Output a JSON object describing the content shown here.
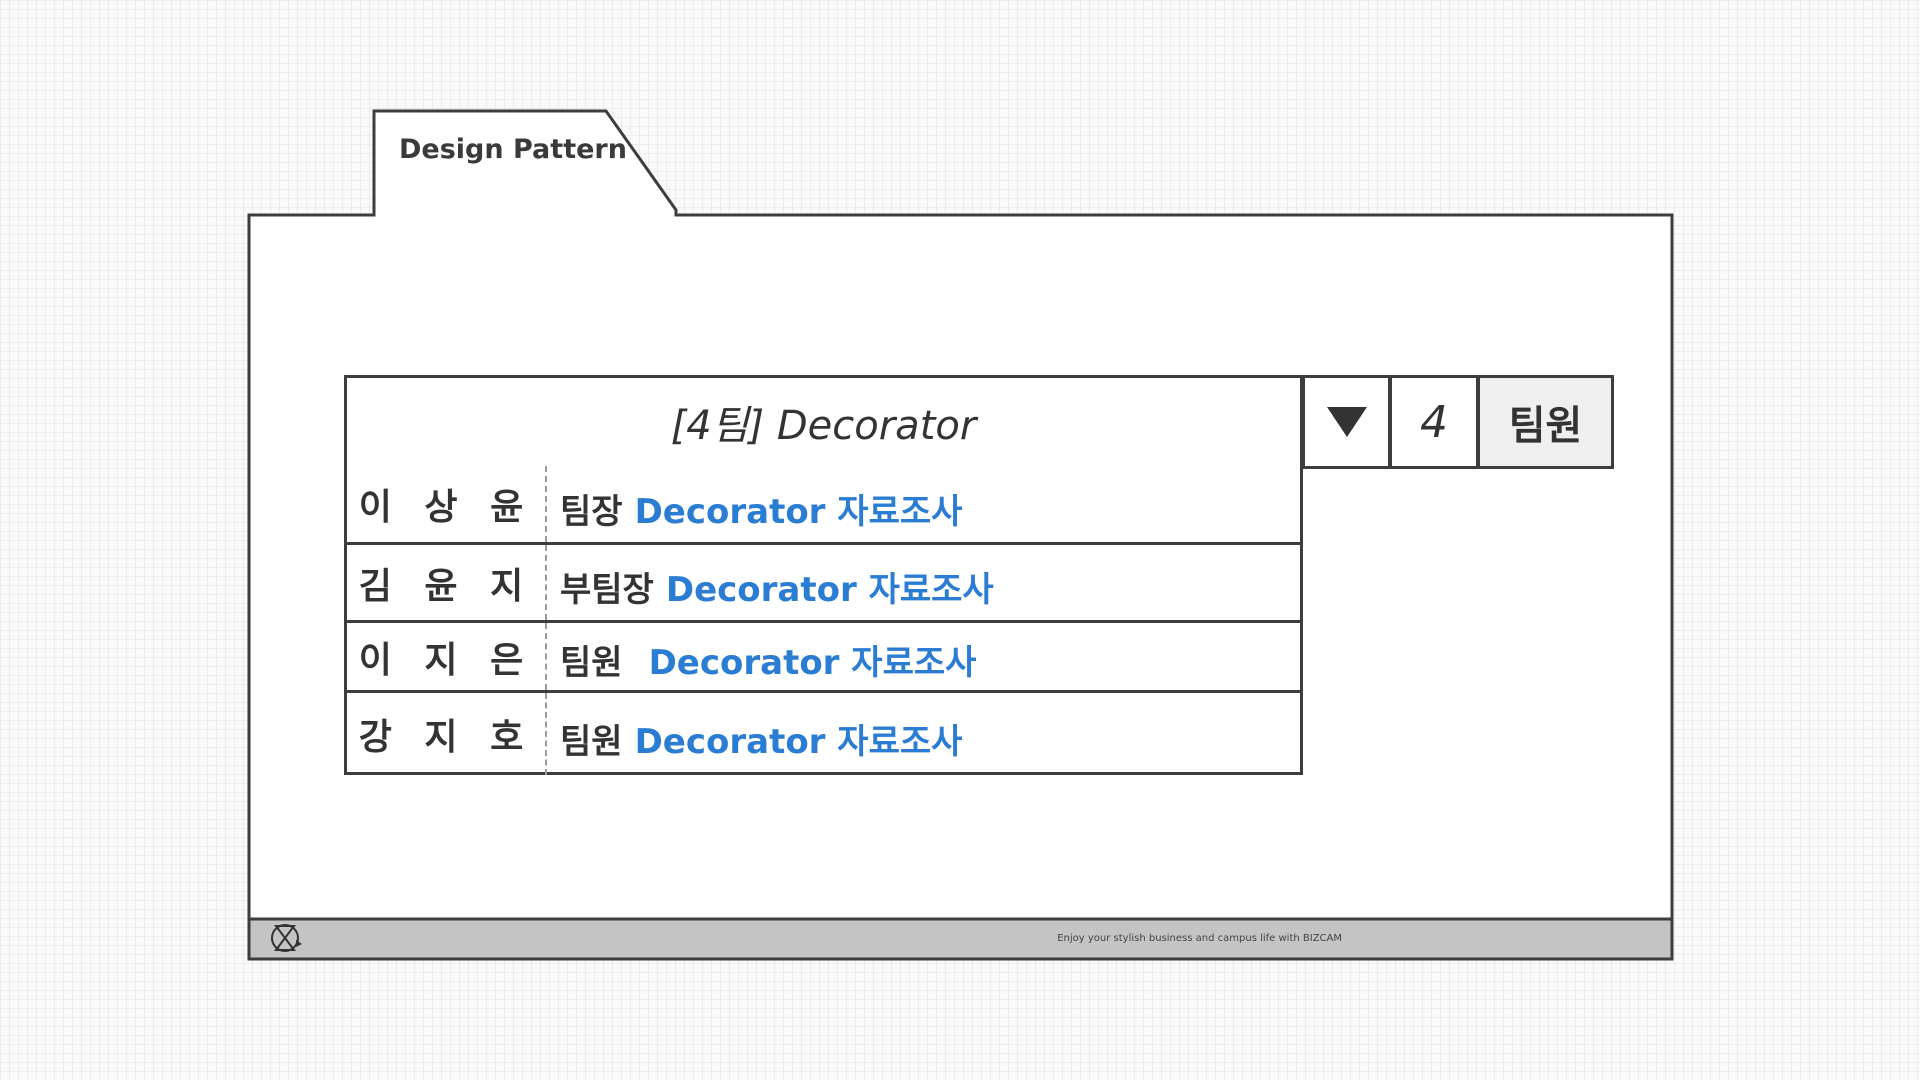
{
  "tab": {
    "label": "Design Pattern"
  },
  "header": {
    "title": "[4팀] Decorator",
    "dropdown_icon": "triangle-down-icon",
    "count": "4",
    "role": "팀원"
  },
  "members": [
    {
      "name": "이 상 윤",
      "role": "팀장",
      "task": "Decorator 자료조사"
    },
    {
      "name": "김 윤 지",
      "role": "부팀장",
      "task": "Decorator 자료조사"
    },
    {
      "name": "이 지 은",
      "role": "팀원",
      "task": "Decorator 자료조사"
    },
    {
      "name": "강 지 호",
      "role": "팀원",
      "task": "Decorator 자료조사"
    }
  ],
  "footer": {
    "tagline": "Enjoy your stylish business and campus life with BIZCAM",
    "logo_icon": "hourglass-logo-icon"
  },
  "colors": {
    "accent_blue": "#2b7cd3",
    "border": "#3d3d3d",
    "footer_bar": "#c4c4c4"
  }
}
